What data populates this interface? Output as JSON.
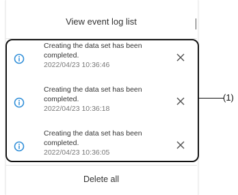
{
  "header": {
    "title": "View event log list"
  },
  "events": [
    {
      "line1": "Creating the data set has been",
      "line2": "completed.",
      "timestamp": "2022/04/23 10:36:46"
    },
    {
      "line1": "Creating the data set has been",
      "line2": "completed.",
      "timestamp": "2022/04/23 10:36:18"
    },
    {
      "line1": "Creating the data set has been",
      "line2": "completed.",
      "timestamp": "2022/04/23 10:36:05"
    }
  ],
  "footer": {
    "delete_all_label": "Delete all"
  },
  "callout": {
    "label": "(1)"
  },
  "icons": {
    "info": "info-icon",
    "close": "close-icon"
  },
  "colors": {
    "info_icon": "#2f8ed8",
    "callout_frame": "#111111"
  }
}
